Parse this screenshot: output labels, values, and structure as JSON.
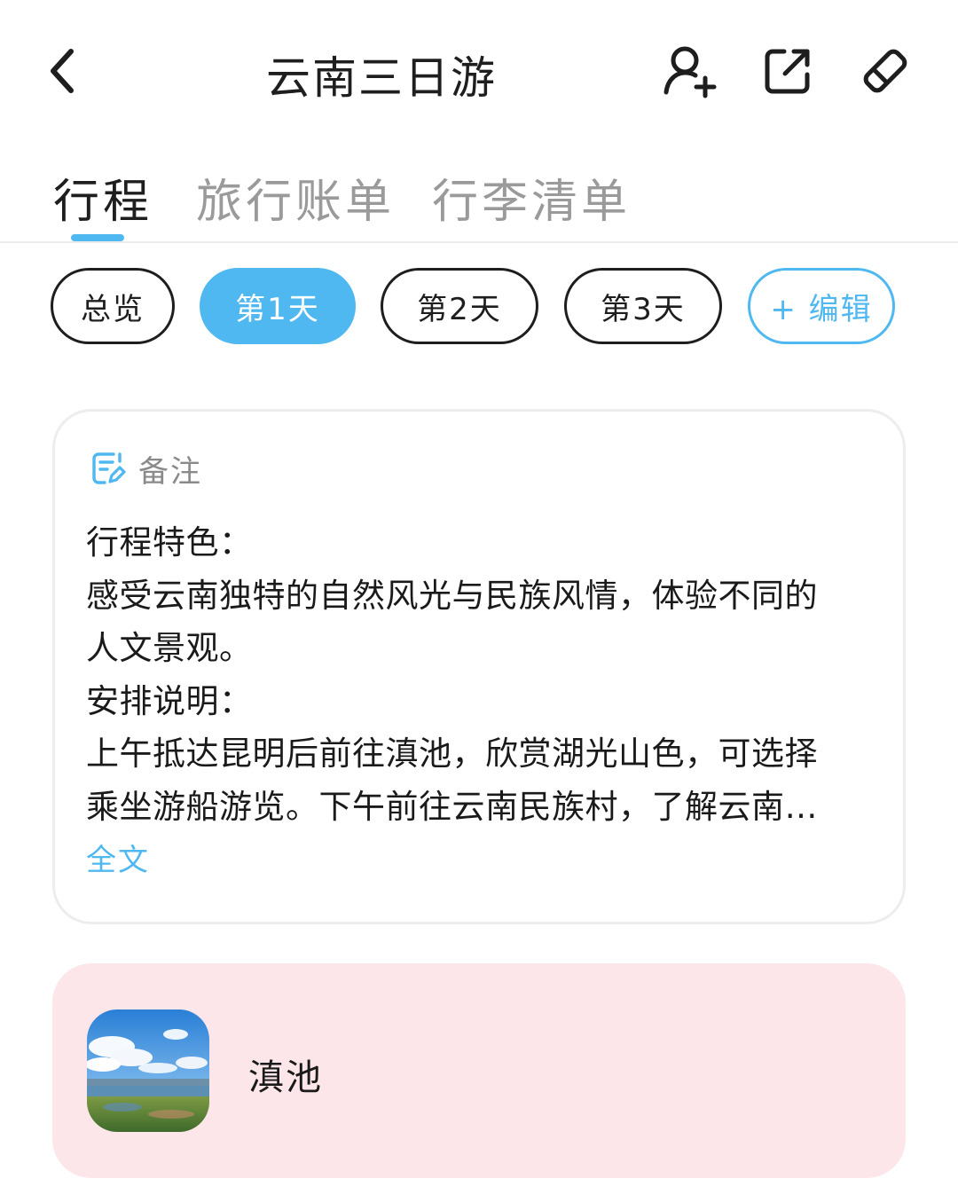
{
  "header": {
    "title": "云南三日游",
    "icons": {
      "back": "chevron-left-icon",
      "add_member": "user-plus-icon",
      "share": "share-external-icon",
      "edit": "eraser-icon"
    }
  },
  "tabs": [
    {
      "label": "行程",
      "active": true
    },
    {
      "label": "旅行账单",
      "active": false
    },
    {
      "label": "行李清单",
      "active": false
    }
  ],
  "day_chips": [
    {
      "label": "总览",
      "active": false
    },
    {
      "label": "第1天",
      "active": true
    },
    {
      "label": "第2天",
      "active": false
    },
    {
      "label": "第3天",
      "active": false
    }
  ],
  "edit_chip": {
    "label": "+ 编辑"
  },
  "note": {
    "label": "备注",
    "icon": "note-edit-icon",
    "lines": [
      "行程特色：",
      "感受云南独特的自然风光与民族风情，体验不同的",
      "人文景观。",
      "安排说明：",
      "上午抵达昆明后前往滇池，欣赏湖光山色，可选择",
      "乘坐游船游览。下午前往云南民族村，了解云南…"
    ],
    "more_label": "全文"
  },
  "poi": {
    "name": "滇池",
    "thumbnail": "lake-landscape-photo"
  },
  "colors": {
    "accent": "#4fb8f0",
    "poi_card_bg": "#fde6ea",
    "text_primary": "#1e1e1e",
    "text_secondary": "#9a9a9a"
  }
}
